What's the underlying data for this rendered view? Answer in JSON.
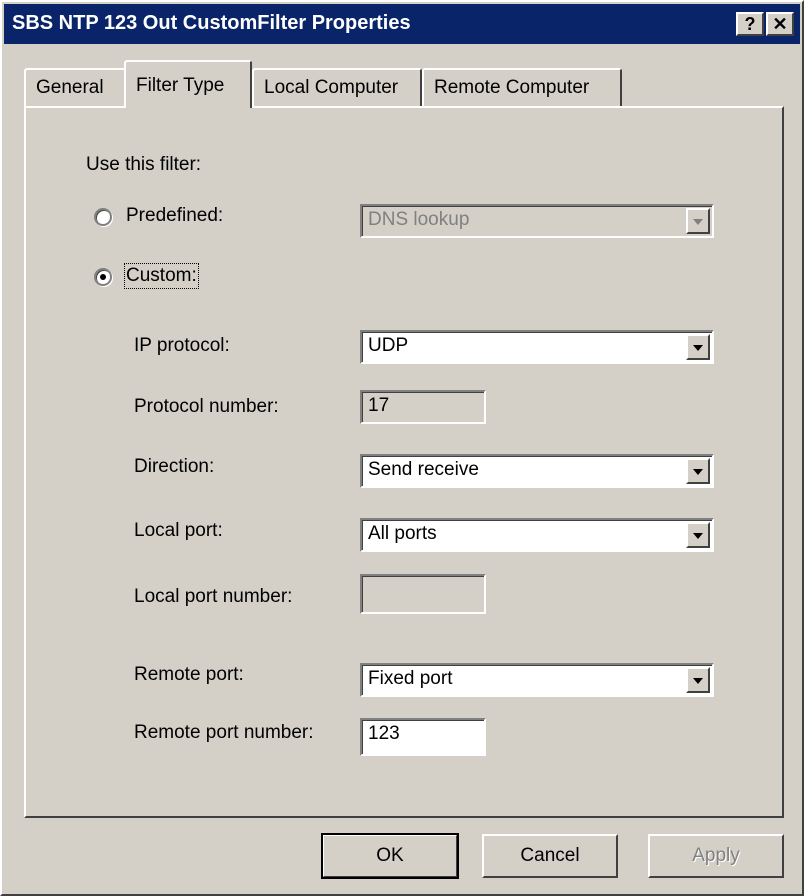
{
  "window": {
    "title": "SBS NTP 123 Out CustomFilter Properties"
  },
  "titlebar_buttons": {
    "help": "?",
    "close": "✕"
  },
  "tabs": [
    {
      "label": "General"
    },
    {
      "label": "Filter Type"
    },
    {
      "label": "Local Computer"
    },
    {
      "label": "Remote Computer"
    }
  ],
  "active_tab": "Filter Type",
  "filter": {
    "heading": "Use this filter:",
    "predefined": {
      "label": "Predefined:",
      "selected": false,
      "value": "DNS lookup"
    },
    "custom": {
      "label": "Custom:",
      "selected": true
    }
  },
  "custom_fields": {
    "ip_protocol": {
      "label": "IP protocol:",
      "value": "UDP"
    },
    "protocol_number": {
      "label": "Protocol number:",
      "value": "17"
    },
    "direction": {
      "label": "Direction:",
      "value": "Send receive"
    },
    "local_port": {
      "label": "Local port:",
      "value": "All ports"
    },
    "local_port_number": {
      "label": "Local port number:",
      "value": ""
    },
    "remote_port": {
      "label": "Remote port:",
      "value": "Fixed port"
    },
    "remote_port_number": {
      "label": "Remote port number:",
      "value": "123"
    }
  },
  "buttons": {
    "ok": "OK",
    "cancel": "Cancel",
    "apply": "Apply"
  }
}
